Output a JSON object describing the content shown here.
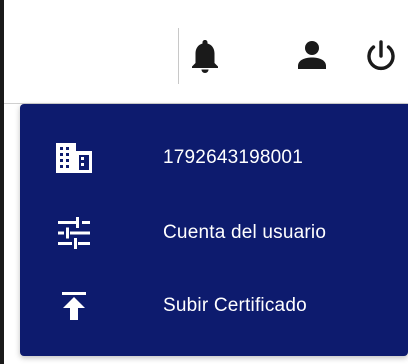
{
  "header": {
    "icons": {
      "notifications": "bell-icon",
      "account": "person-icon",
      "logout": "power-icon"
    }
  },
  "menu": {
    "items": [
      {
        "label": "1792643198001",
        "icon": "building-icon"
      },
      {
        "label": "Cuenta del usuario",
        "icon": "sliders-icon"
      },
      {
        "label": "Subir Certificado",
        "icon": "upload-icon"
      }
    ]
  },
  "colors": {
    "menu_background": "#0d1b6e",
    "menu_text": "#ffffff",
    "icon_dark": "#1a1a1a"
  }
}
